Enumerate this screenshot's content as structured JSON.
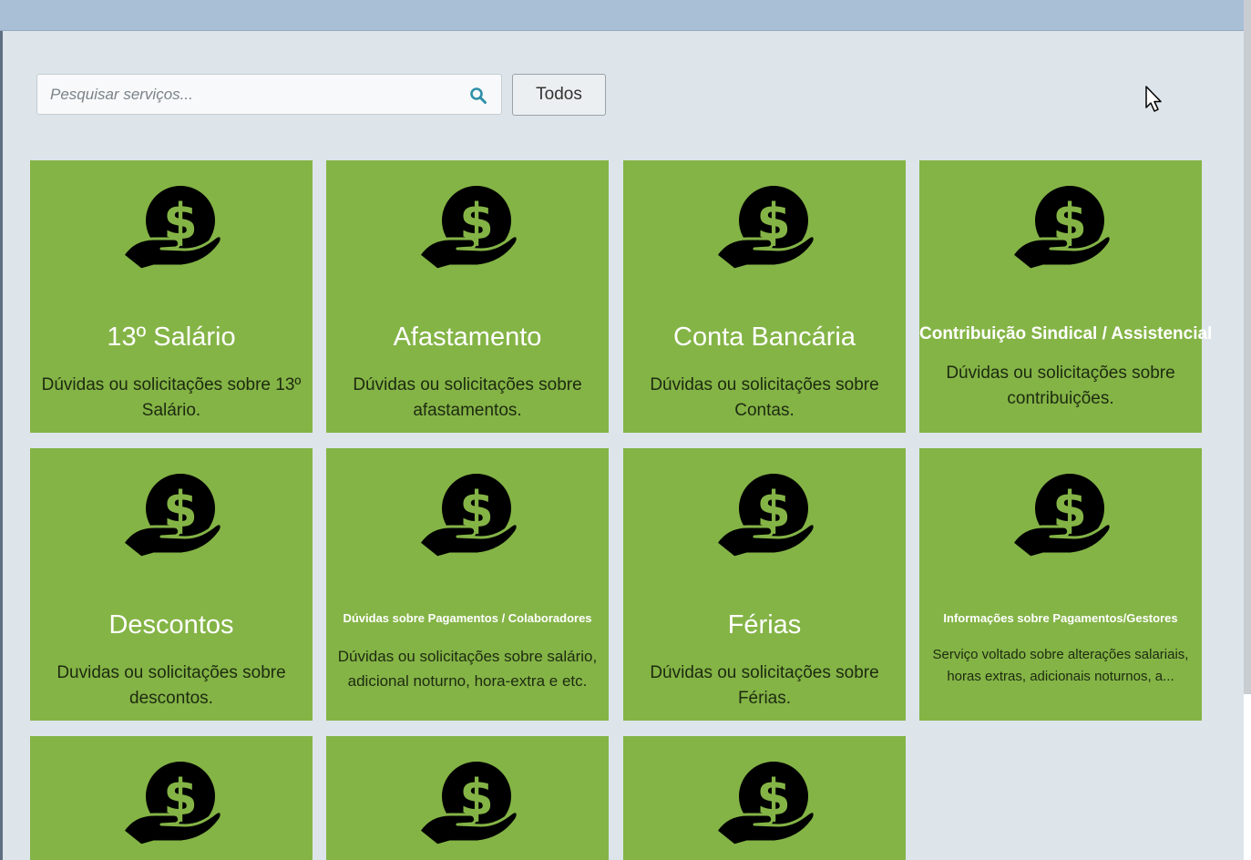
{
  "search": {
    "placeholder": "Pesquisar serviços..."
  },
  "filter": {
    "todos_label": "Todos"
  },
  "services": [
    {
      "title": "13º Salário",
      "description": "Dúvidas ou solicitações sobre 13º Salário.",
      "icon": "money-hand-icon"
    },
    {
      "title": "Afastamento",
      "description": "Dúvidas ou solicitações sobre afastamentos.",
      "icon": "money-hand-icon"
    },
    {
      "title": "Conta Bancária",
      "description": "Dúvidas ou solicitações sobre Contas.",
      "icon": "money-hand-icon"
    },
    {
      "title": "Contribuição Sindical / Assistencial",
      "description": "Dúvidas ou solicitações sobre contribuições.",
      "icon": "money-hand-icon"
    },
    {
      "title": "Descontos",
      "description": "Duvidas ou solicitações sobre descontos.",
      "icon": "money-hand-icon"
    },
    {
      "title": "Dúvidas sobre Pagamentos / Colaboradores",
      "description": "Dúvidas ou solicitações sobre salário, adicional noturno, hora-extra e etc.",
      "icon": "money-hand-icon"
    },
    {
      "title": "Férias",
      "description": "Dúvidas ou solicitações sobre Férias.",
      "icon": "money-hand-icon"
    },
    {
      "title": "Informações sobre Pagamentos/Gestores",
      "description": "Serviço voltado sobre alterações salariais, horas extras, adicionais noturnos, a...",
      "icon": "money-hand-icon"
    },
    {
      "title": "",
      "description": "",
      "icon": "money-hand-icon"
    },
    {
      "title": "",
      "description": "",
      "icon": "money-hand-icon"
    },
    {
      "title": "",
      "description": "",
      "icon": "money-hand-icon"
    }
  ],
  "colors": {
    "tile": "#84b446",
    "background": "#dde5ea",
    "topbar": "#a9bfd6",
    "search_icon": "#2e8fa8"
  }
}
